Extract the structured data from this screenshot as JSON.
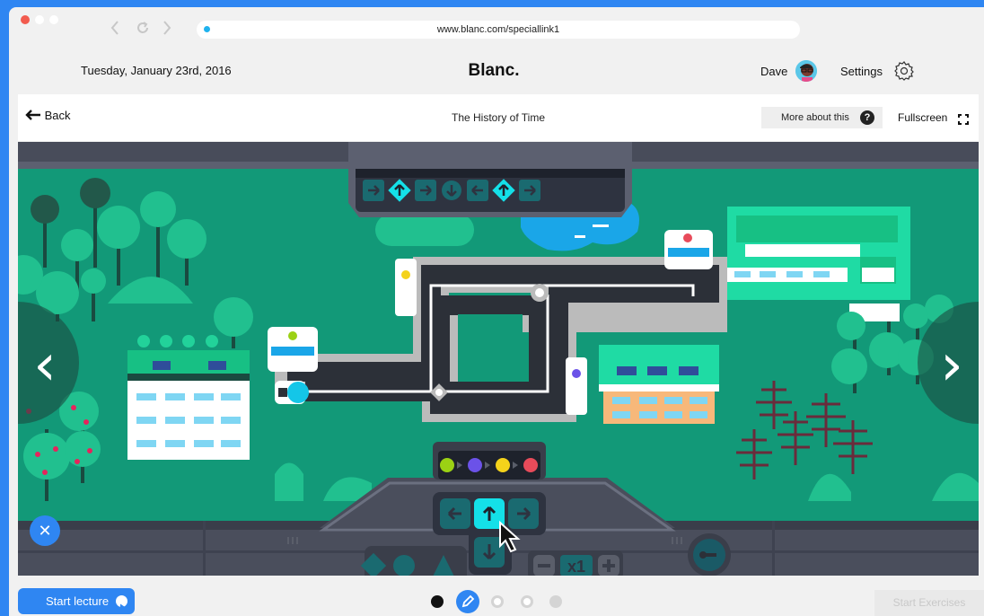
{
  "browser": {
    "url": "www.blanc.com/speciallink1"
  },
  "header": {
    "date": "Tuesday, January 23rd, 2016",
    "brand": "Blanc.",
    "user_name": "Dave",
    "settings_label": "Settings"
  },
  "lesson_bar": {
    "back_label": "Back",
    "title": "The History of Time",
    "more_label": "More about this",
    "help_glyph": "?",
    "fullscreen_label": "Fullscreen"
  },
  "stage": {
    "nav_prev_glyph": "‹",
    "nav_next_glyph": "›",
    "multiplier_label": "x1"
  },
  "footer": {
    "close_glyph": "✕",
    "start_lecture_label": "Start lecture",
    "start_exercises_label": "Start Exercises",
    "active_page": 2,
    "page_count": 5
  },
  "colors": {
    "accent": "#2f86f2",
    "stage_green": "#129978",
    "cyan": "#14e0e8"
  },
  "icons": [
    "back-arrow-icon",
    "help-icon",
    "fullscreen-icon",
    "gear-icon",
    "play-icon",
    "close-icon",
    "pencil-icon",
    "cursor-icon",
    "key-icon"
  ]
}
